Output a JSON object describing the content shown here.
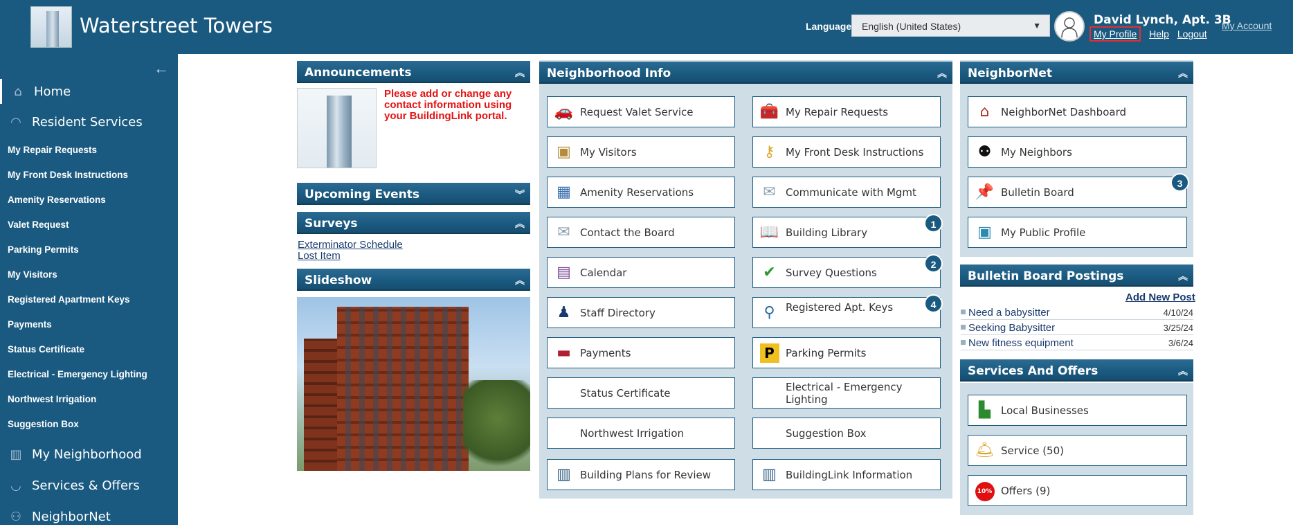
{
  "header": {
    "brand": "Waterstreet Towers",
    "language_label": "Language:",
    "language_value": "English (United States)",
    "user_name": "David Lynch, Apt. 3B",
    "links": [
      "My Profile",
      "Help",
      "Logout"
    ],
    "my_account": "My Account"
  },
  "sidebar": {
    "main": [
      "Home",
      "Resident Services",
      "My Neighborhood",
      "Services & Offers",
      "NeighborNet"
    ],
    "sub": [
      "My Repair Requests",
      "My Front Desk Instructions",
      "Amenity Reservations",
      "Valet Request",
      "Parking Permits",
      "My Visitors",
      "Registered Apartment Keys",
      "Payments",
      "Status Certificate",
      "Electrical - Emergency Lighting",
      "Northwest Irrigation",
      "Suggestion Box"
    ]
  },
  "panels": {
    "announcements": "Announcements",
    "announcement_text": "Please add or change any contact information using your BuildingLink portal.",
    "upcoming_events": "Upcoming Events",
    "surveys": "Surveys",
    "survey_links": [
      "Exterminator Schedule",
      "Lost Item"
    ],
    "slideshow": "Slideshow",
    "neighborhood_info": "Neighborhood Info",
    "neighbornet": "NeighborNet",
    "bulletin_postings": "Bulletin Board Postings",
    "services_offers": "Services And Offers"
  },
  "neighborhood_tiles": {
    "left": [
      "Request Valet Service",
      "My Visitors",
      "Amenity Reservations",
      "Contact the Board",
      "Calendar",
      "Staff Directory",
      "Payments",
      "Status Certificate",
      "Northwest Irrigation",
      "Building Plans for Review"
    ],
    "right": [
      "My Repair Requests",
      "My Front Desk Instructions",
      "Communicate with Mgmt",
      "Building Library",
      "Survey Questions",
      "Registered Apt. Keys",
      "Parking Permits",
      "Electrical - Emergency Lighting",
      "Suggestion Box",
      "BuildingLink Information"
    ],
    "badges": {
      "building_library": "1",
      "survey_questions": "2",
      "registered_keys": "4",
      "bulletin_board": "3"
    }
  },
  "neighbornet_tiles": [
    "NeighborNet Dashboard",
    "My Neighbors",
    "Bulletin Board",
    "My Public Profile"
  ],
  "bulletin": {
    "add_new": "Add New Post",
    "posts": [
      {
        "title": "Need a babysitter",
        "date": "4/10/24"
      },
      {
        "title": "Seeking Babysitter",
        "date": "3/25/24"
      },
      {
        "title": "New fitness equipment",
        "date": "3/6/24"
      }
    ]
  },
  "services_tiles": [
    "Local Businesses",
    "Service (50)",
    "Offers (9)"
  ],
  "colors": {
    "brand": "#1a5a80",
    "alert": "#e31414",
    "panel_bg": "#cfdde6"
  }
}
